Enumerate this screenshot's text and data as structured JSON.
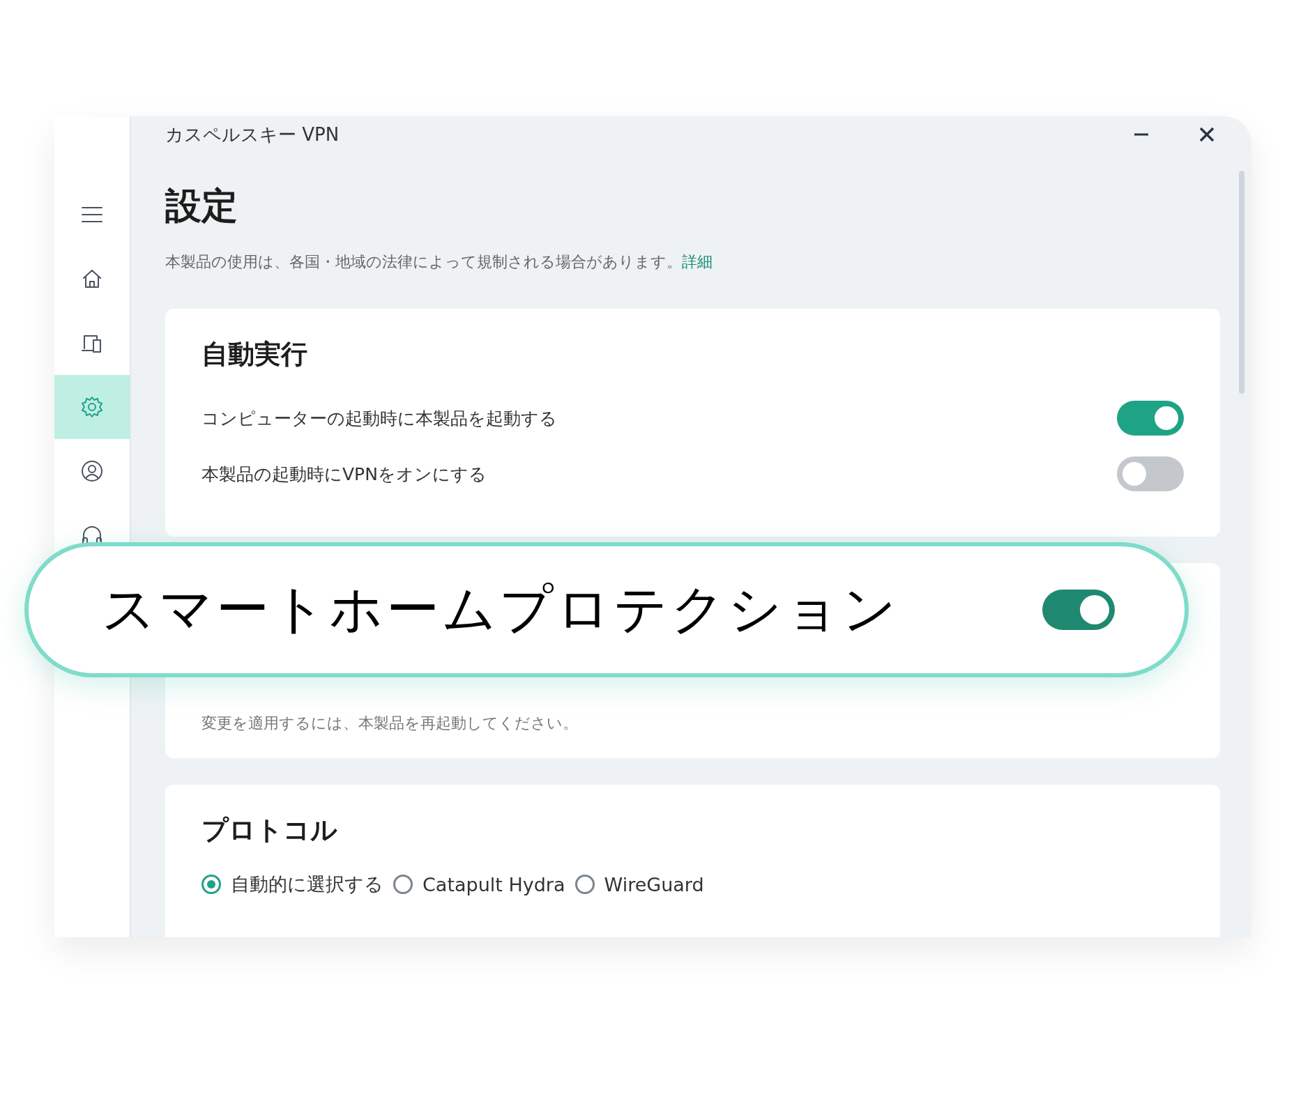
{
  "window": {
    "title": "カスペルスキー VPN"
  },
  "sidebar": {
    "items": [
      {
        "kind": "menu",
        "selected": false
      },
      {
        "kind": "home",
        "selected": false
      },
      {
        "kind": "devices",
        "selected": false
      },
      {
        "kind": "settings",
        "selected": true
      },
      {
        "kind": "account",
        "selected": false
      },
      {
        "kind": "support",
        "selected": false
      }
    ]
  },
  "page": {
    "heading": "設定",
    "notice": "本製品の使用は、各国・地域の法律によって規制される場合があります。",
    "notice_link": "詳細"
  },
  "sections": [
    {
      "title": "自動実行",
      "options": [
        {
          "label": "コンピューターの起動時に本製品を起動する",
          "on": true
        },
        {
          "label": "本製品の起動時にVPNをオンにする",
          "on": false
        }
      ]
    },
    {
      "note": "変更を適用するには、本製品を再起動してください。"
    },
    {
      "title": "プロトコル",
      "choices": [
        {
          "label": "自動的に選択する",
          "selected": true
        },
        {
          "label": "Catapult Hydra",
          "selected": false
        },
        {
          "label": "WireGuard",
          "selected": false
        }
      ]
    }
  ],
  "callout": {
    "label": "スマートホームプロテクション",
    "on": true
  }
}
